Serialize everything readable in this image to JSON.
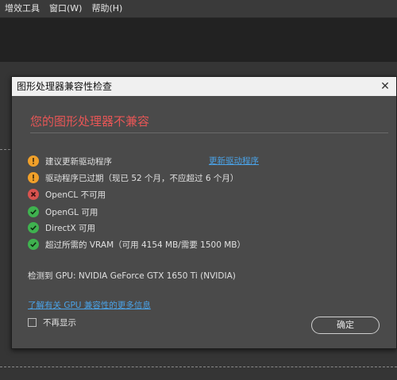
{
  "menubar": {
    "items": [
      "增效工具",
      "窗口(W)",
      "帮助(H)"
    ]
  },
  "dialog": {
    "title": "图形处理器兼容性检查",
    "close_label": "✕",
    "heading": "您的图形处理器不兼容",
    "items": [
      {
        "status": "warning",
        "icon": "warning-icon",
        "text": "建议更新驱动程序"
      },
      {
        "status": "warning",
        "icon": "warning-icon",
        "text": "驱动程序已过期（现已 52 个月，不应超过 6 个月）"
      },
      {
        "status": "error",
        "icon": "error-icon",
        "text": "OpenCL 不可用"
      },
      {
        "status": "ok",
        "icon": "check-icon",
        "text": "OpenGL 可用"
      },
      {
        "status": "ok",
        "icon": "check-icon",
        "text": "DirectX 可用"
      },
      {
        "status": "ok",
        "icon": "check-icon",
        "text": "超过所需的 VRAM（可用 4154 MB/需要 1500 MB）"
      }
    ],
    "update_driver_link": "更新驱动程序",
    "gpu_detected": "检测到 GPU: NVIDIA GeForce GTX 1650 Ti (NVIDIA)",
    "more_info_link": "了解有关 GPU 兼容性的更多信息",
    "dont_show_again": "不再显示",
    "ok_button": "确定"
  },
  "colors": {
    "heading": "#e85656",
    "link": "#4aa3e8",
    "warning": "#f0a02a",
    "error": "#d9534f",
    "ok": "#3fb24f"
  }
}
